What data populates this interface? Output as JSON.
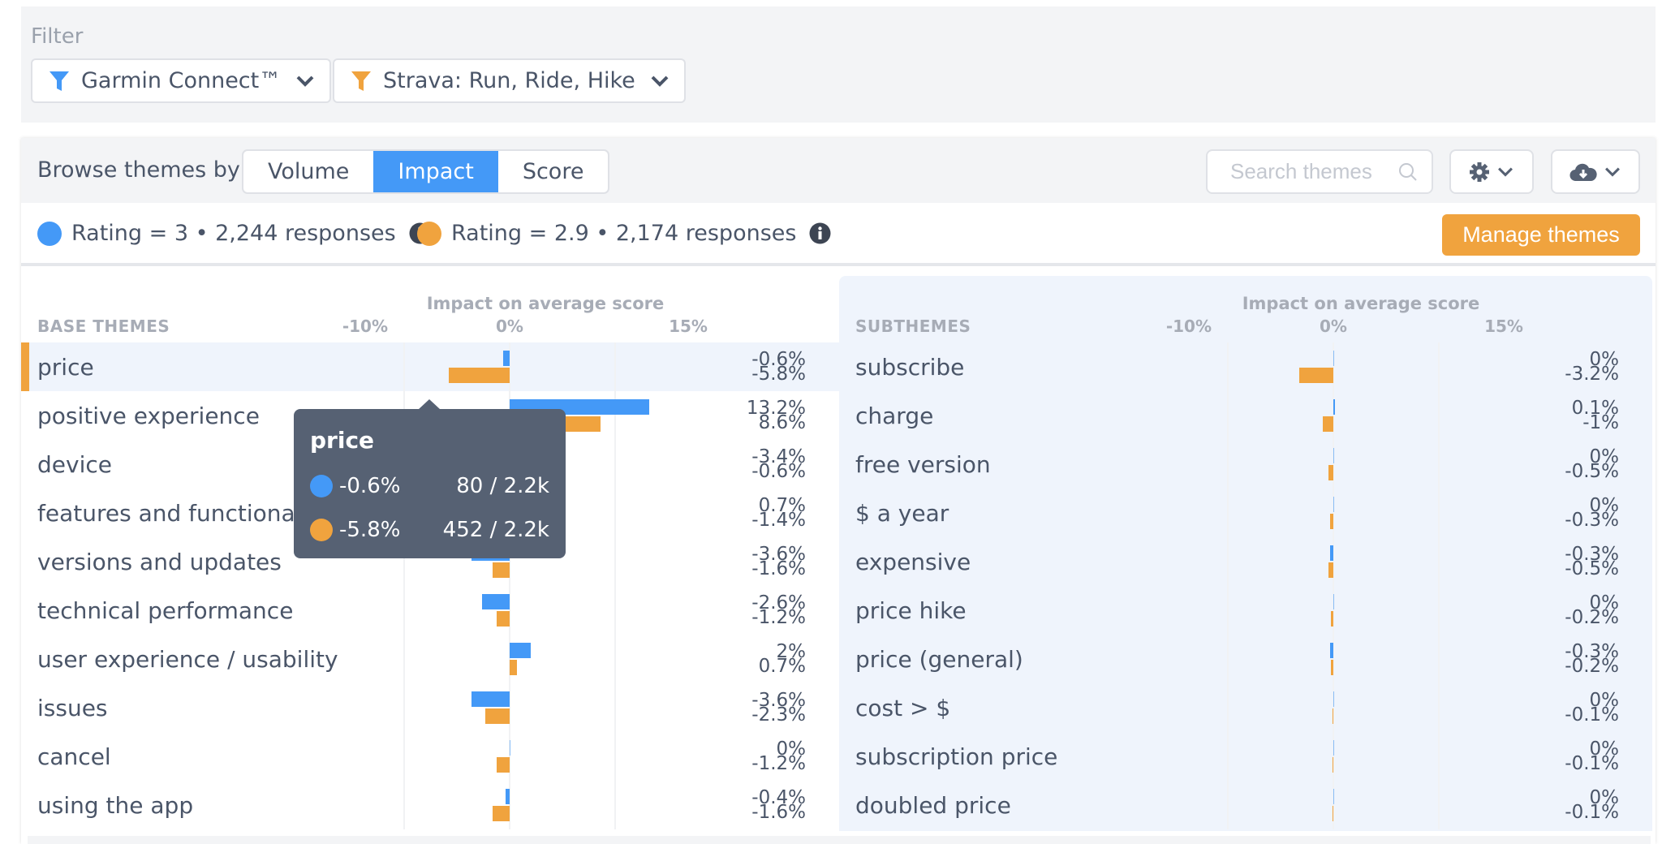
{
  "filter": {
    "title": "Filter",
    "buttons": [
      {
        "label": "Garmin Connect™",
        "color": "#4499f7"
      },
      {
        "label": "Strava: Run, Ride, Hike",
        "color": "#f0a33e"
      }
    ]
  },
  "toolbar": {
    "browse_label": "Browse themes by",
    "modes": [
      {
        "label": "Volume",
        "active": false
      },
      {
        "label": "Impact",
        "active": true
      },
      {
        "label": "Score",
        "active": false
      }
    ],
    "search_placeholder": "Search themes",
    "settings_icon": "gear-icon",
    "download_icon": "cloud-download-icon"
  },
  "legend": {
    "series": [
      {
        "label": "Rating = 3 • 2,244 responses",
        "color": "#4499f7"
      },
      {
        "label": "Rating = 2.9 • 2,174 responses",
        "color": "#f0a33e"
      }
    ],
    "manage_button": "Manage themes"
  },
  "colors": {
    "blue": "#4499f7",
    "orange": "#f0a33e"
  },
  "chart_data": [
    {
      "type": "bar",
      "title": "Impact on average score",
      "column_header": "BASE THEMES",
      "tick_labels": [
        "-10%",
        "0%",
        "15%"
      ],
      "gridlines": [
        -10,
        0,
        10
      ],
      "categories": [
        "price",
        "positive experience",
        "device",
        "features and functionality",
        "versions and updates",
        "technical performance",
        "user experience / usability",
        "issues",
        "cancel",
        "using the app"
      ],
      "series": [
        {
          "name": "Rating = 3",
          "values": [
            -0.6,
            13.2,
            -3.4,
            0.7,
            -3.6,
            -2.6,
            2,
            -3.6,
            0,
            -0.4
          ],
          "labels": [
            "-0.6%",
            "13.2%",
            "-3.4%",
            "0.7%",
            "-3.6%",
            "-2.6%",
            "2%",
            "-3.6%",
            "0%",
            "-0.4%"
          ]
        },
        {
          "name": "Rating = 2.9",
          "values": [
            -5.8,
            8.6,
            -0.6,
            -1.4,
            -1.6,
            -1.2,
            0.7,
            -2.3,
            -1.2,
            -1.6
          ],
          "labels": [
            "-5.8%",
            "8.6%",
            "-0.6%",
            "-1.4%",
            "-1.6%",
            "-1.2%",
            "0.7%",
            "-2.3%",
            "-1.2%",
            "-1.6%"
          ]
        }
      ],
      "selected": "price"
    },
    {
      "type": "bar",
      "title": "Impact on average score",
      "column_header": "SUBTHEMES",
      "tick_labels": [
        "-10%",
        "0%",
        "15%"
      ],
      "gridlines": [
        -10,
        0,
        10
      ],
      "categories": [
        "subscribe",
        "charge",
        "free version",
        "$ a year",
        "expensive",
        "price hike",
        "price (general)",
        "cost > $",
        "subscription price",
        "doubled price"
      ],
      "series": [
        {
          "name": "Rating = 3",
          "values": [
            0,
            0.1,
            0,
            0,
            -0.3,
            0,
            -0.3,
            0,
            0,
            0
          ],
          "labels": [
            "0%",
            "0.1%",
            "0%",
            "0%",
            "-0.3%",
            "0%",
            "-0.3%",
            "0%",
            "0%",
            "0%"
          ]
        },
        {
          "name": "Rating = 2.9",
          "values": [
            -3.2,
            -1,
            -0.5,
            -0.3,
            -0.5,
            -0.2,
            -0.2,
            -0.1,
            -0.1,
            -0.1
          ],
          "labels": [
            "-3.2%",
            "-1%",
            "-0.5%",
            "-0.3%",
            "-0.5%",
            "-0.2%",
            "-0.2%",
            "-0.1%",
            "-0.1%",
            "-0.1%"
          ]
        }
      ]
    }
  ],
  "tooltip": {
    "title": "price",
    "rows": [
      {
        "value": "-0.6%",
        "count": "80 / 2.2k",
        "color": "#4499f7"
      },
      {
        "value": "-5.8%",
        "count": "452 / 2.2k",
        "color": "#f0a33e"
      }
    ]
  }
}
